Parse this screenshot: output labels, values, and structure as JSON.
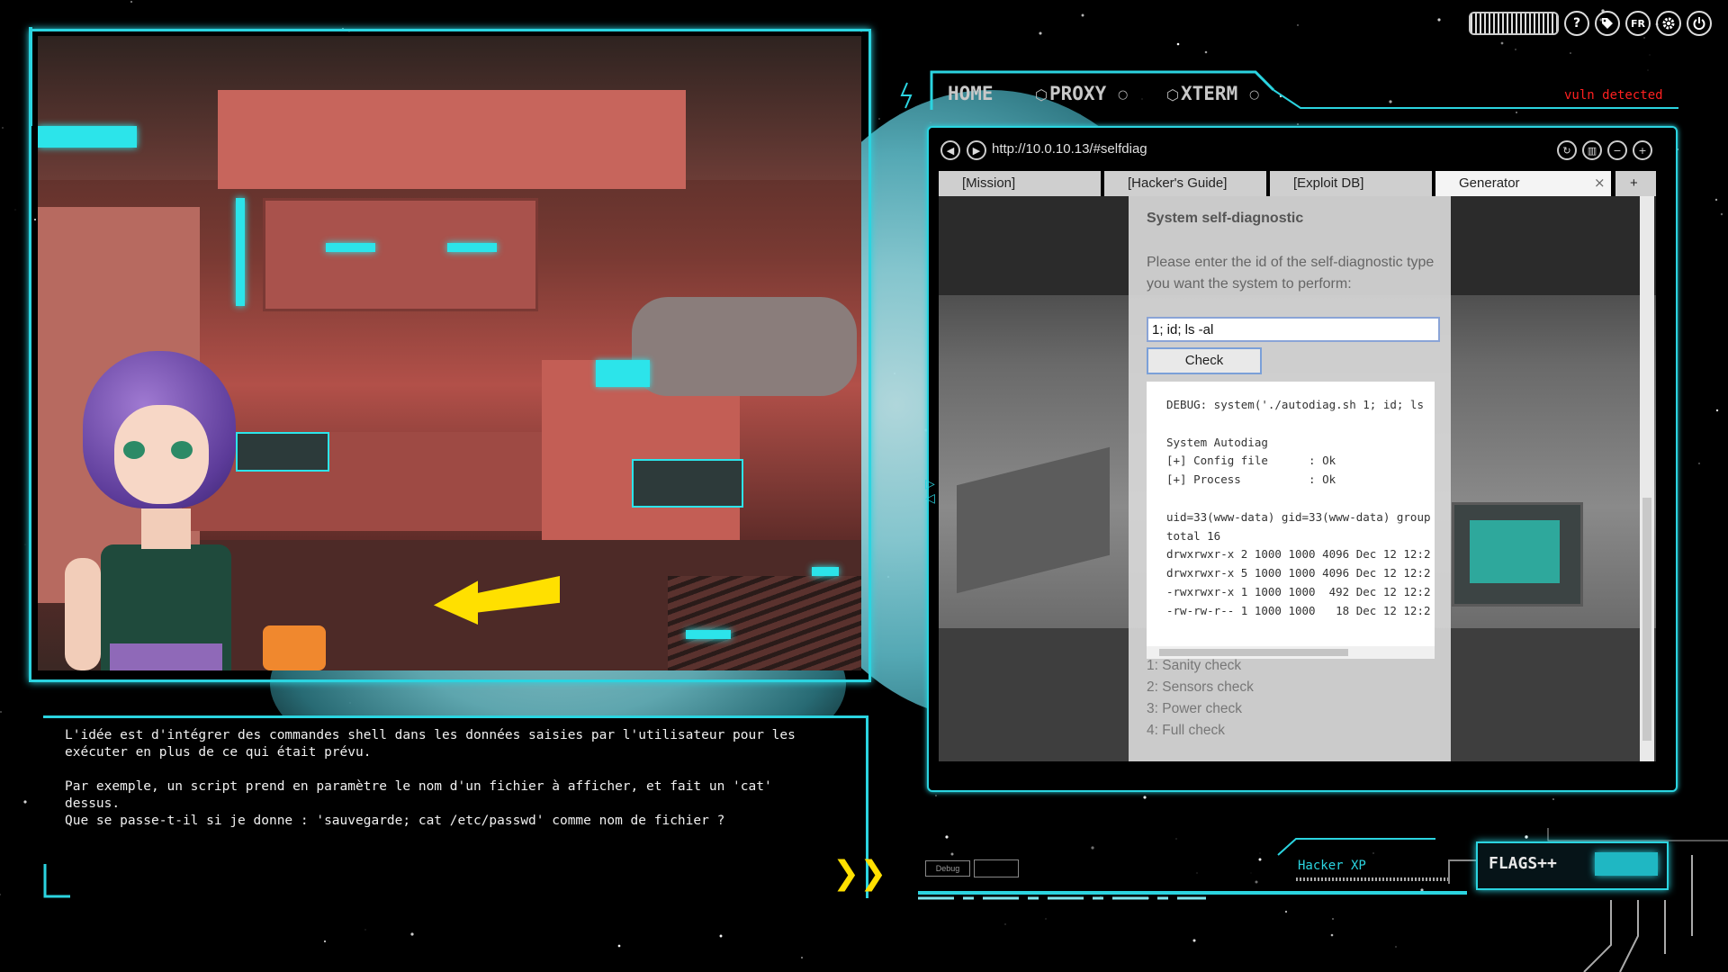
{
  "top_icons": {
    "help": "?",
    "lang": "FR"
  },
  "nav": {
    "home": "HOME",
    "proxy": "PROXY",
    "xterm": "XTERM",
    "alert": "vuln detected"
  },
  "browser": {
    "url": "http://10.0.10.13/#selfdiag",
    "tabs": [
      "[Mission]",
      "[Hacker's Guide]",
      "[Exploit DB]",
      "Generator"
    ],
    "close": "×",
    "new_tab": "+",
    "page": {
      "title": "System self-diagnostic",
      "description": "Please enter the id of the self-diagnostic type you want the system to perform:",
      "input_value": "1; id; ls -al",
      "button": "Check",
      "output": "DEBUG: system('./autodiag.sh 1; id; ls\n\nSystem Autodiag\n[+] Config file      : Ok\n[+] Process          : Ok\n\nuid=33(www-data) gid=33(www-data) group\ntotal 16\ndrwxrwxr-x 2 1000 1000 4096 Dec 12 12:2\ndrwxrwxr-x 5 1000 1000 4096 Dec 12 12:2\n-rwxrwxr-x 1 1000 1000  492 Dec 12 12:2\n-rw-rw-r-- 1 1000 1000   18 Dec 12 12:2",
      "options": [
        "1: Sanity check",
        "2: Sensors check",
        "3: Power check",
        "4: Full check"
      ]
    }
  },
  "dialogue": {
    "text": "L'idée est d'intégrer des commandes shell dans les données saisies par l'utilisateur pour les\nexécuter en plus de ce qui était prévu.\n\nPar exemple, un script prend en paramètre le nom d'un fichier à afficher, et fait un 'cat'\ndessus.\nQue se passe-t-il si je donne : 'sauvegarde; cat /etc/passwd' comme nom de fichier ?",
    "next": "❯❯"
  },
  "hud": {
    "debug": "Debug",
    "profile": "Hacker XP",
    "flags": "FLAGS++"
  },
  "colors": {
    "accent": "#2bd4e0",
    "alert": "#ff2020",
    "next_arrow": "#ffe000"
  }
}
